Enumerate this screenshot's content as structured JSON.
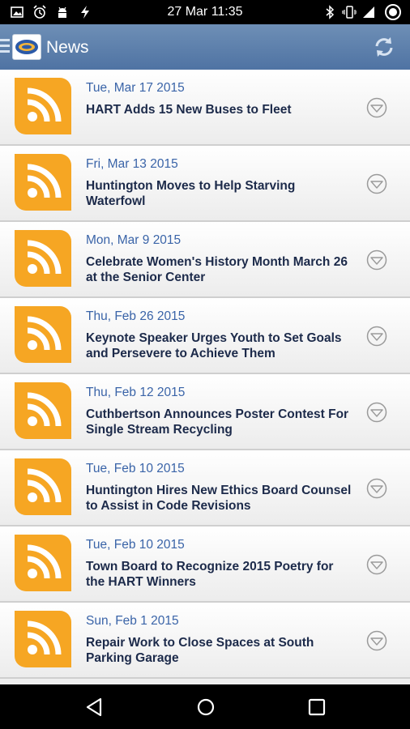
{
  "status_bar": {
    "time": "27 Mar 11:35",
    "left_icons": [
      "image-icon",
      "alarm-icon",
      "android-icon",
      "flash-icon"
    ],
    "right_icons": [
      "bluetooth-icon",
      "vibrate-icon",
      "signal-icon",
      "battery-icon"
    ]
  },
  "action_bar": {
    "title": "News",
    "menu_icon": "menu-icon",
    "refresh_icon": "refresh-icon"
  },
  "news_items": [
    {
      "date": "Tue, Mar 17 2015",
      "title": "HART Adds 15 New Buses to Fleet"
    },
    {
      "date": "Fri, Mar 13 2015",
      "title": "Huntington Moves to Help Starving Waterfowl"
    },
    {
      "date": "Mon, Mar 9 2015",
      "title": "Celebrate Women's History Month March 26 at the Senior Center"
    },
    {
      "date": "Thu, Feb 26 2015",
      "title": "Keynote Speaker Urges Youth to Set Goals and Persevere to Achieve Them"
    },
    {
      "date": "Thu, Feb 12 2015",
      "title": "Cuthbertson Announces Poster Contest For Single Stream Recycling"
    },
    {
      "date": "Tue, Feb 10 2015",
      "title": "Huntington Hires New Ethics Board Counsel to Assist in Code Revisions"
    },
    {
      "date": "Tue, Feb 10 2015",
      "title": "Town Board to Recognize 2015 Poetry for the HART Winners"
    },
    {
      "date": "Sun, Feb 1 2015",
      "title": "Repair Work to Close Spaces at South Parking Garage"
    }
  ],
  "colors": {
    "action_bar": "#5a7dab",
    "rss_orange": "#f6a623",
    "date_blue": "#3a64a8",
    "title_navy": "#1c2a4a"
  },
  "nav_bar": {
    "icons": [
      "back-icon",
      "home-icon",
      "recents-icon"
    ]
  }
}
